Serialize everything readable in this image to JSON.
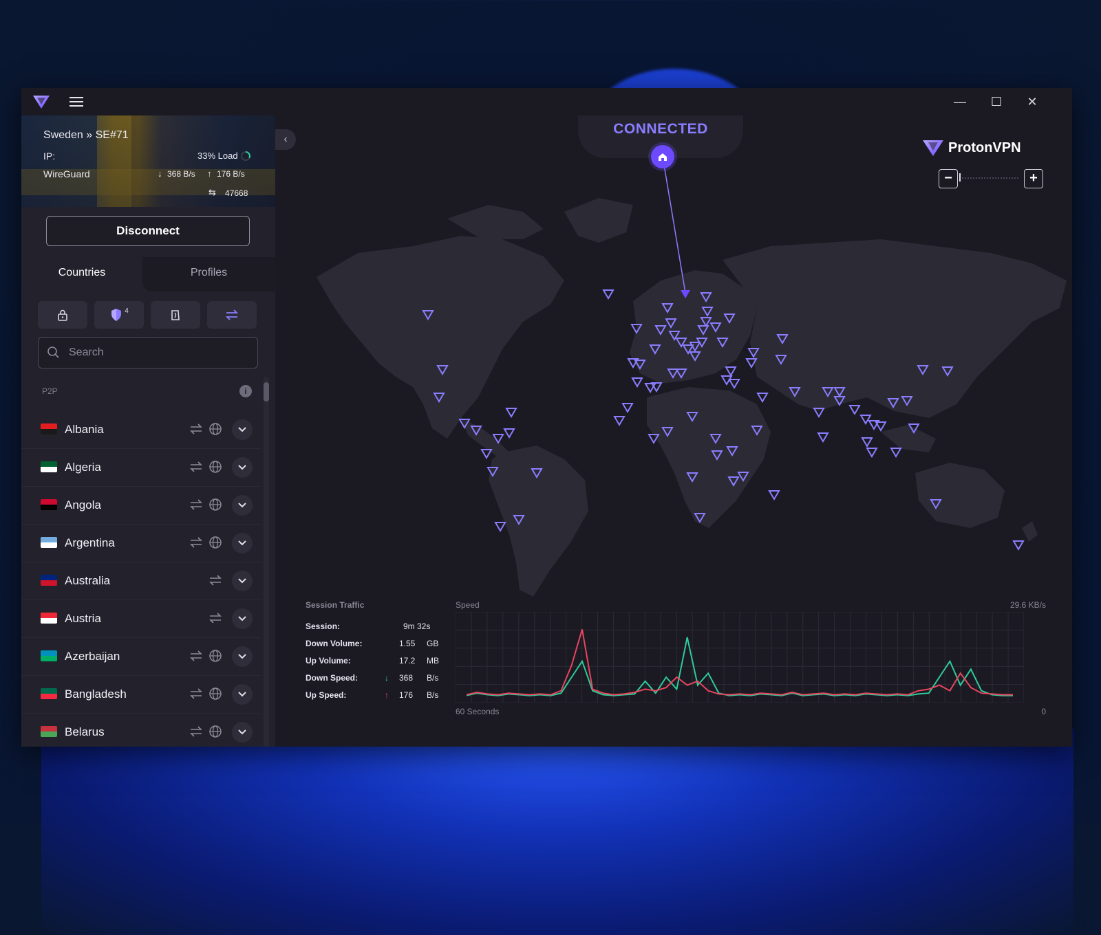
{
  "app": {
    "menu_icon": "hamburger-icon",
    "window_controls": [
      "minimize",
      "maximize",
      "close"
    ]
  },
  "connection": {
    "server": "Sweden » SE#71",
    "ip_label": "IP:",
    "load": "33% Load",
    "protocol": "WireGuard",
    "down_rate": "368 B/s",
    "up_rate": "176 B/s",
    "port": "47668",
    "disconnect_label": "Disconnect"
  },
  "tabs": {
    "countries": "Countries",
    "profiles": "Profiles"
  },
  "filters": {
    "secure_core": "lock-icon",
    "netshield": "shield-icon",
    "netshield_count": "4",
    "tor": "onion-icon",
    "p2p": "p2p-icon"
  },
  "search": {
    "placeholder": "Search"
  },
  "list": {
    "section": "P2P",
    "countries": [
      {
        "name": "Albania",
        "p2p": true,
        "tor": true,
        "flag": [
          "#e41e20",
          "#1a1a1a"
        ]
      },
      {
        "name": "Algeria",
        "p2p": true,
        "tor": true,
        "flag": [
          "#006233",
          "#ffffff"
        ]
      },
      {
        "name": "Angola",
        "p2p": true,
        "tor": true,
        "flag": [
          "#cc092f",
          "#000000"
        ]
      },
      {
        "name": "Argentina",
        "p2p": true,
        "tor": true,
        "flag": [
          "#74acdf",
          "#ffffff"
        ]
      },
      {
        "name": "Australia",
        "p2p": true,
        "tor": false,
        "flag": [
          "#00247d",
          "#cf142b"
        ]
      },
      {
        "name": "Austria",
        "p2p": true,
        "tor": false,
        "flag": [
          "#ed2939",
          "#ffffff"
        ]
      },
      {
        "name": "Azerbaijan",
        "p2p": true,
        "tor": true,
        "flag": [
          "#0092bc",
          "#00af66"
        ]
      },
      {
        "name": "Bangladesh",
        "p2p": true,
        "tor": true,
        "flag": [
          "#006a4e",
          "#f42a41"
        ]
      },
      {
        "name": "Belarus",
        "p2p": true,
        "tor": true,
        "flag": [
          "#c8313e",
          "#4aa657"
        ]
      }
    ]
  },
  "map": {
    "status": "CONNECTED",
    "brand_name": "ProtonVPN",
    "accent": "#6d4aff",
    "marker_color": "#8a7dff"
  },
  "session": {
    "title": "Session Traffic",
    "rows": [
      {
        "label": "Session:",
        "value": "9m 32s",
        "unit": "",
        "arrow": ""
      },
      {
        "label": "Down Volume:",
        "value": "1.55",
        "unit": "GB",
        "arrow": ""
      },
      {
        "label": "Up Volume:",
        "value": "17.2",
        "unit": "MB",
        "arrow": ""
      },
      {
        "label": "Down Speed:",
        "value": "368",
        "unit": "B/s",
        "arrow": "↓"
      },
      {
        "label": "Up Speed:",
        "value": "176",
        "unit": "B/s",
        "arrow": "↑"
      }
    ]
  },
  "speed_graph": {
    "title": "Speed",
    "max_label": "29.6 KB/s",
    "x_start_label": "60 Seconds",
    "x_end_label": "0",
    "down_color": "#2ecc9a",
    "up_color": "#e8455f",
    "down_series": [
      0.02,
      0.05,
      0.03,
      0.02,
      0.04,
      0.03,
      0.02,
      0.03,
      0.02,
      0.05,
      0.25,
      0.45,
      0.08,
      0.03,
      0.02,
      0.03,
      0.04,
      0.2,
      0.05,
      0.25,
      0.1,
      0.75,
      0.15,
      0.3,
      0.05,
      0.02,
      0.03,
      0.02,
      0.04,
      0.03,
      0.02,
      0.05,
      0.02,
      0.03,
      0.04,
      0.02,
      0.03,
      0.02,
      0.04,
      0.03,
      0.02,
      0.03,
      0.02,
      0.04,
      0.05,
      0.25,
      0.45,
      0.15,
      0.35,
      0.08,
      0.03,
      0.02,
      0.02
    ],
    "up_series": [
      0.03,
      0.06,
      0.04,
      0.03,
      0.05,
      0.04,
      0.03,
      0.04,
      0.03,
      0.08,
      0.4,
      0.85,
      0.1,
      0.05,
      0.03,
      0.04,
      0.06,
      0.1,
      0.08,
      0.12,
      0.25,
      0.15,
      0.2,
      0.08,
      0.04,
      0.03,
      0.04,
      0.03,
      0.05,
      0.04,
      0.03,
      0.06,
      0.03,
      0.04,
      0.05,
      0.03,
      0.04,
      0.03,
      0.05,
      0.04,
      0.03,
      0.04,
      0.03,
      0.08,
      0.1,
      0.15,
      0.08,
      0.3,
      0.12,
      0.05,
      0.04,
      0.03,
      0.03
    ]
  }
}
